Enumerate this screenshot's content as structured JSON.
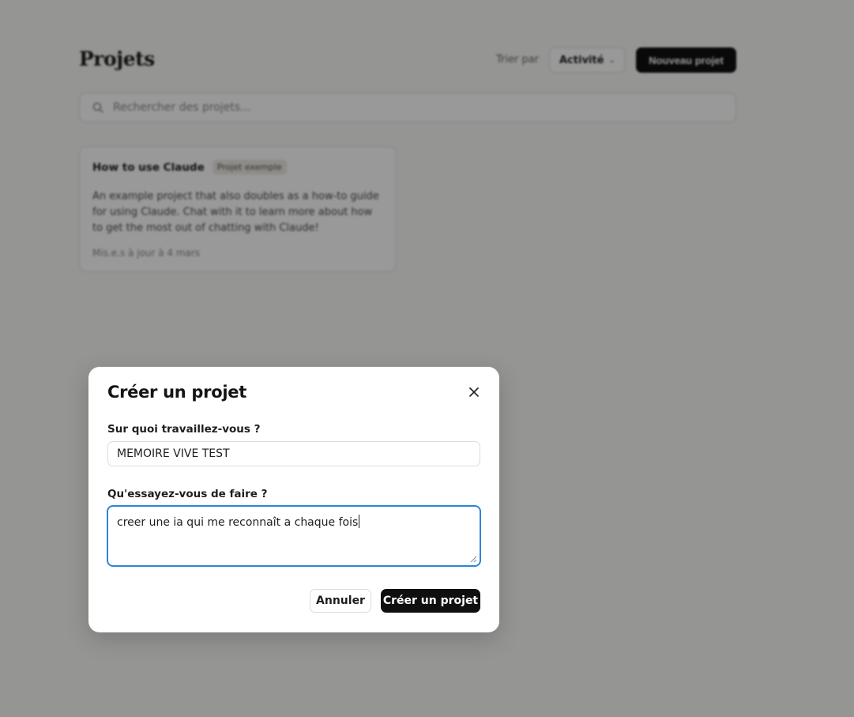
{
  "background": {
    "page_title": "Projets",
    "sort_label": "Trier par",
    "sort_value": "Activité",
    "new_project_label": "Nouveau projet",
    "search_placeholder": "Rechercher des projets...",
    "project_card": {
      "title": "How to use Claude",
      "tag": "Projet exemple",
      "description": "An example project that also doubles as a how-to guide for using Claude. Chat with it to learn more about how to get the most out of chatting with Claude!",
      "meta": "Mis.e.s à jour à 4 mars"
    }
  },
  "modal": {
    "title": "Créer un projet",
    "field1_label": "Sur quoi travaillez-vous ?",
    "field1_value": "MEMOIRE VIVE TEST",
    "field2_label": "Qu'essayez-vous de faire ?",
    "field2_value": "creer une ia qui me reconnaît a chaque fois",
    "cancel_label": "Annuler",
    "create_label": "Créer un projet"
  },
  "colors": {
    "focus_border": "#2c84db",
    "primary_button": "#0f0f0f",
    "overlay": "rgba(0,0,0,0.4)"
  },
  "icons": {
    "close": "close-icon",
    "search": "search-icon",
    "sort_chevron": "chevron-down-icon"
  }
}
